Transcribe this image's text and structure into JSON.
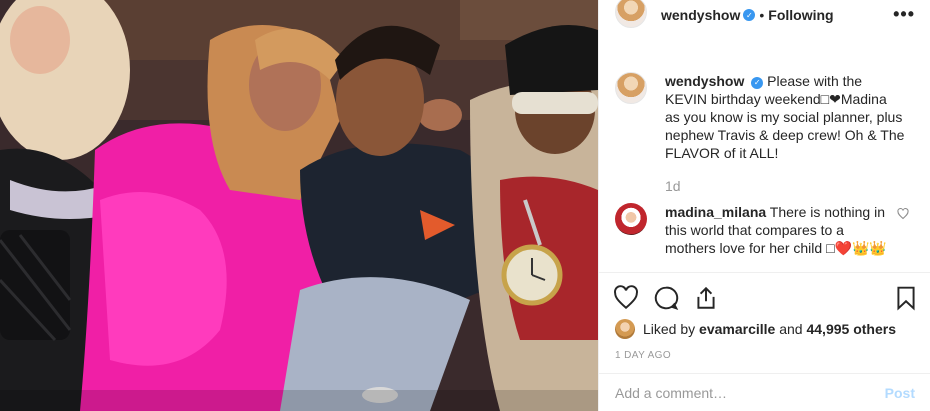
{
  "header": {
    "username": "wendyshow",
    "verified_glyph": "✓",
    "separator": "•",
    "follow_status": "Following",
    "more_glyph": "•••"
  },
  "caption": {
    "username": "wendyshow",
    "text": "Please with the KEVIN birthday weekend□❤Madina as you know is my social planner, plus nephew Travis & deep crew! Oh & The FLAVOR of it ALL!",
    "time": "1d"
  },
  "comment": {
    "username": "madina_milana",
    "text": "There is nothing in this world that compares to a mothers love for her child □❤️👑👑"
  },
  "icons": {
    "like": "heart-icon",
    "comment": "comment-icon",
    "share": "share-icon",
    "save": "bookmark-icon",
    "comment_like": "heart-icon"
  },
  "likes": {
    "prefix": "Liked by ",
    "user": "evamarcille",
    "middle": " and ",
    "count": "44,995 others"
  },
  "post_time": "1 DAY AGO",
  "add_comment": {
    "placeholder": "Add a comment…",
    "post_label": "Post"
  },
  "colors": {
    "accent": "#3897f0",
    "muted": "#999999",
    "post_disabled": "#b3dbff"
  }
}
